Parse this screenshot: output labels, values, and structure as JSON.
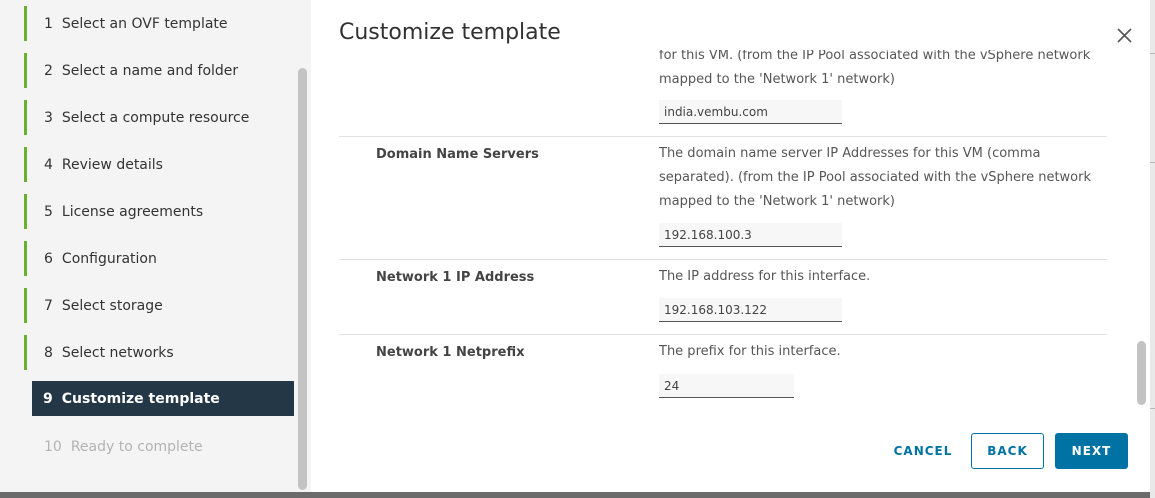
{
  "nav": {
    "steps": [
      {
        "num": "1",
        "label": "Select an OVF template"
      },
      {
        "num": "2",
        "label": "Select a name and folder"
      },
      {
        "num": "3",
        "label": "Select a compute resource"
      },
      {
        "num": "4",
        "label": "Review details"
      },
      {
        "num": "5",
        "label": "License agreements"
      },
      {
        "num": "6",
        "label": "Configuration"
      },
      {
        "num": "7",
        "label": "Select storage"
      },
      {
        "num": "8",
        "label": "Select networks"
      },
      {
        "num": "9",
        "label": "Customize template"
      },
      {
        "num": "10",
        "label": "Ready to complete"
      }
    ],
    "active_step": "9"
  },
  "dialog": {
    "title": "Customize template",
    "close_icon": "close-icon"
  },
  "rows": [
    {
      "label": "",
      "desc_line1": "for this VM. (from the IP Pool associated with the vSphere network",
      "desc_line2": "mapped to the 'Network 1' network)",
      "value": "india.vembu.com"
    },
    {
      "label": "Domain Name Servers",
      "desc_line1": "The domain name server IP Addresses for this VM (comma",
      "desc_line2": "separated). (from the IP Pool associated with the vSphere network",
      "desc_line3": "mapped to the 'Network 1' network)",
      "value": "192.168.100.3"
    },
    {
      "label": "Network 1 IP Address",
      "desc_line1": "The IP address for this interface.",
      "value": "192.168.103.122"
    },
    {
      "label": "Network 1 Netprefix",
      "desc_line1": "The prefix for this interface.",
      "value": "24"
    }
  ],
  "footer": {
    "cancel_label": "CANCEL",
    "back_label": "BACK",
    "next_label": "NEXT"
  },
  "colors": {
    "accent": "#0072a3",
    "progress_green": "#67b12c",
    "active_bg": "#243747"
  }
}
